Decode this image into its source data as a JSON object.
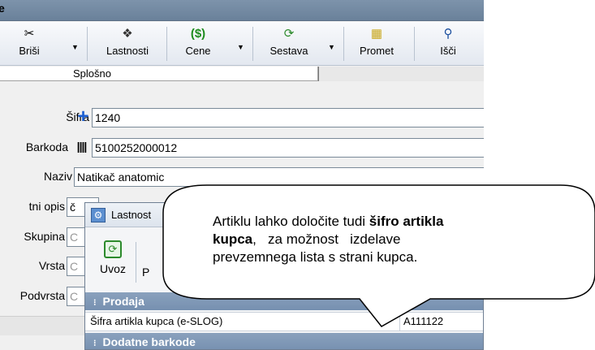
{
  "window": {
    "title": "e"
  },
  "toolbar": {
    "items": [
      {
        "label": "Briši",
        "icon": "scissors-icon",
        "glyph": "✂",
        "dropdown": true
      },
      {
        "label": "Lastnosti",
        "icon": "properties-icon",
        "glyph": "❖",
        "dropdown": false
      },
      {
        "label": "Cene",
        "icon": "price-icon",
        "glyph": "$",
        "dropdown": true
      },
      {
        "label": "Sestava",
        "icon": "composition-icon",
        "glyph": "⟳",
        "dropdown": true
      },
      {
        "label": "Promet",
        "icon": "traffic-icon",
        "glyph": "▦",
        "dropdown": false
      },
      {
        "label": "Išči",
        "icon": "search-icon",
        "glyph": "⚲",
        "dropdown": false
      }
    ]
  },
  "tabs": {
    "active": "Splošno"
  },
  "form": {
    "sifra": {
      "label": "Šifra",
      "value": "1240"
    },
    "barkoda": {
      "label": "Barkoda",
      "value": "5100252000012"
    },
    "naziv": {
      "label": "Naziv",
      "value": "Natikač anatomic"
    },
    "opis": {
      "label": "tni opis",
      "value": "č"
    },
    "skupina": {
      "label": "Skupina",
      "value": "C"
    },
    "vrsta": {
      "label": "Vrsta",
      "value": "C"
    },
    "podvrsta": {
      "label": "Podvrsta",
      "value": "C"
    }
  },
  "dialog": {
    "title": "Lastnost",
    "uvoz_label": "Uvoz",
    "second_label": "P",
    "group_prodaja": "Prodaja",
    "row_key": "Šifra artikla kupca (e-SLOG)",
    "row_value": "A111122",
    "group_dodatne": "Dodatne barkode"
  },
  "callout": {
    "line1_pre": "Artiklu lahko določite tudi ",
    "line1_bold": "šifro artikla",
    "line2_bold": "kupca",
    "line2_rest": ",   za možnost   izdelave",
    "line3": "prevzemnega lista s strani kupca."
  },
  "colors": {
    "titlebar": "#7d93ab",
    "group_header": "#7d96b5",
    "plus": "#1c5fd1"
  }
}
